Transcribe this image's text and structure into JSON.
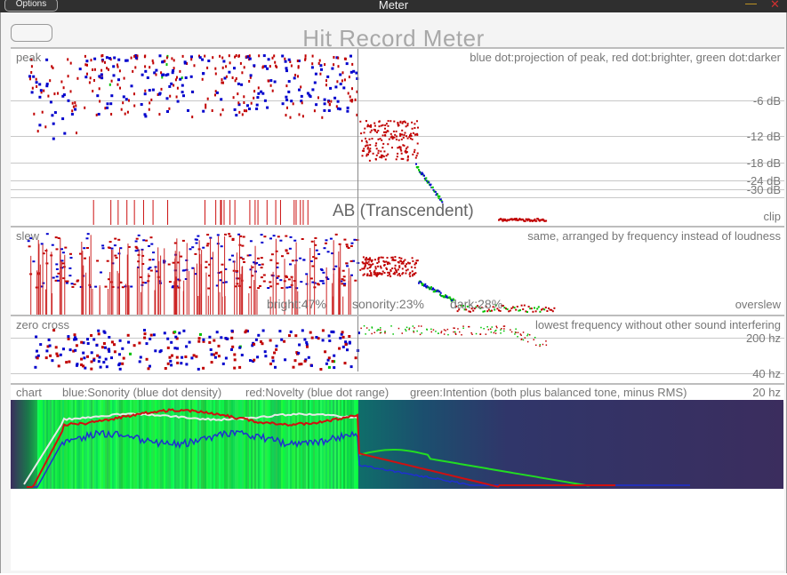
{
  "window": {
    "title": "Meter",
    "options_label": "Options",
    "minimize_glyph": "—",
    "close_glyph": "✕"
  },
  "app_title": "Hit Record Meter",
  "peak_panel": {
    "label": "peak",
    "legend": "blue dot:projection of peak, red dot:brighter, green dot:darker",
    "db_labels": [
      "-6 dB",
      "-12 dB",
      "-18 dB",
      "-24 dB",
      "-30 dB"
    ],
    "clip_label": "clip",
    "verdict": "AB (Transcendent)"
  },
  "slew_panel": {
    "label": "slew",
    "legend": "same, arranged by frequency instead of loudness",
    "overslew_label": "overslew",
    "stats": {
      "bright": "bright:47%",
      "sonority": "sonority:23%",
      "dark": "dark:28%"
    }
  },
  "zero_panel": {
    "label": "zero cross",
    "legend": "lowest frequency without other sound interfering",
    "hz_labels": [
      "200 hz",
      "40 hz",
      "20 hz"
    ]
  },
  "chart_panel": {
    "label": "chart",
    "legend_blue": "blue:Sonority (blue dot density)",
    "legend_red": "red:Novelty (blue dot range)",
    "legend_green": "green:Intention (both plus balanced tone, minus RMS)"
  },
  "colors": {
    "blue": "#0000cc",
    "red": "#c00000",
    "green": "#00c000",
    "chart_bg": "#3b2d5e",
    "chart_green": "#14f04a"
  }
}
